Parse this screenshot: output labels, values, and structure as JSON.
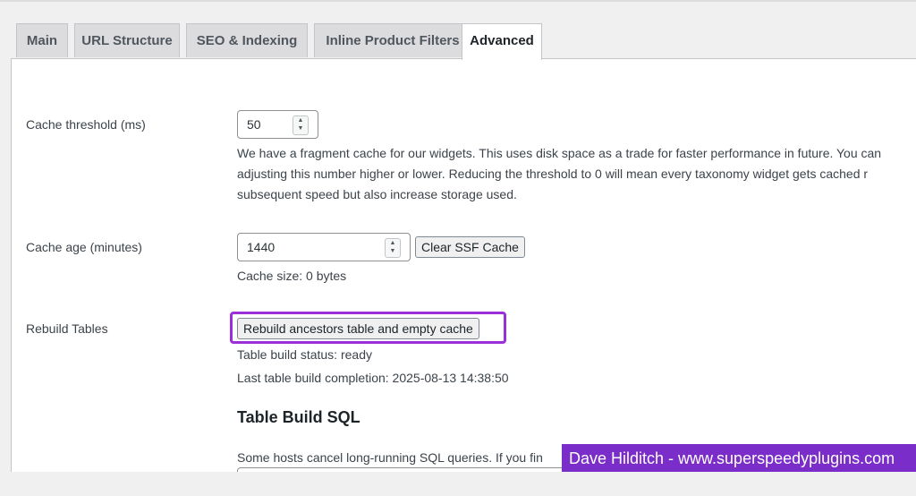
{
  "tabs": [
    {
      "label": "Main"
    },
    {
      "label": "URL Structure"
    },
    {
      "label": "SEO & Indexing"
    },
    {
      "label": "Inline Product Filters"
    },
    {
      "label": "Advanced"
    }
  ],
  "active_tab": "Advanced",
  "cache_threshold": {
    "label": "Cache threshold (ms)",
    "value": "50",
    "desc_lines": [
      "We have a fragment cache for our widgets. This uses disk space as a trade for faster performance in future. You can",
      "adjusting this number higher or lower. Reducing the threshold to 0 will mean every taxonomy widget gets cached r",
      "subsequent speed but also increase storage used."
    ]
  },
  "cache_age": {
    "label": "Cache age (minutes)",
    "value": "1440",
    "clear_button": "Clear SSF Cache",
    "cache_size": "Cache size: 0 bytes"
  },
  "rebuild": {
    "label": "Rebuild Tables",
    "button": "Rebuild ancestors table and empty cache",
    "status": "Table build status: ready",
    "last_completion": "Last table build completion: 2025-08-13 14:38:50"
  },
  "sql_section": {
    "heading": "Table Build SQL",
    "desc": "Some hosts cancel long-running SQL queries. If you fin"
  },
  "watermark": "Dave Hilditch - www.superspeedyplugins.com",
  "colors": {
    "accent": "#7a2dc9",
    "highlight": "#9b30d9"
  },
  "icons": {
    "spinner": "number-spinner-icon"
  }
}
